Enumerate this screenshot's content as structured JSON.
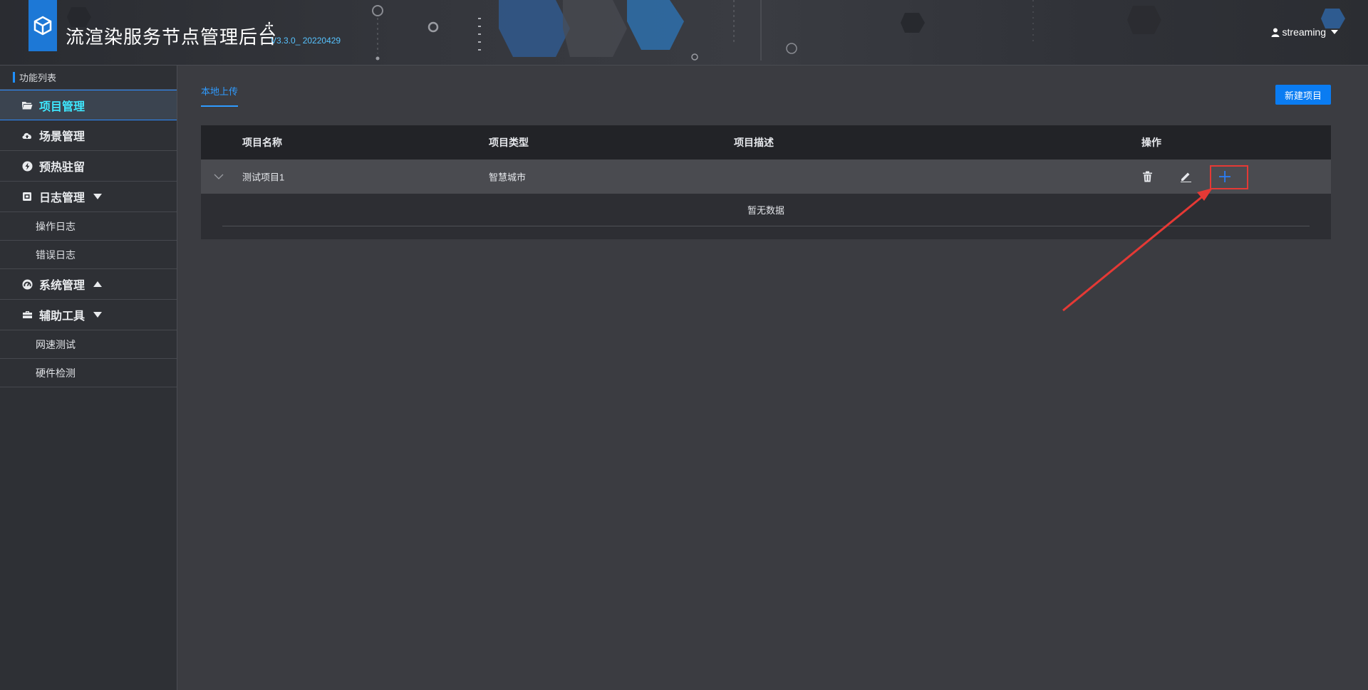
{
  "header": {
    "title": "流渲染服务节点管理后台",
    "sparkle": "✢",
    "version": "V3.3.0_ 20220429",
    "user": "streaming"
  },
  "sidebar": {
    "caption": "功能列表",
    "items": [
      {
        "label": "项目管理",
        "icon": "folder-open-icon",
        "active": true
      },
      {
        "label": "场景管理",
        "icon": "cloud-upload-icon"
      },
      {
        "label": "预热驻留",
        "icon": "bolt-circle-icon"
      },
      {
        "label": "日志管理",
        "icon": "log-box-icon",
        "expanded": true,
        "children": [
          "操作日志",
          "错误日志"
        ]
      },
      {
        "label": "系统管理",
        "icon": "gauge-icon",
        "expanded": false
      },
      {
        "label": "辅助工具",
        "icon": "toolbox-icon",
        "expanded": true,
        "children": [
          "网速测试",
          "硬件检测"
        ]
      }
    ]
  },
  "main": {
    "tab_label": "本地上传",
    "new_button": "新建项目",
    "table": {
      "columns": [
        "项目名称",
        "项目类型",
        "项目描述",
        "操作"
      ],
      "rows": [
        {
          "name": "测试项目1",
          "type": "智慧城市",
          "description": ""
        }
      ],
      "empty_text": "暂无数据"
    }
  },
  "colors": {
    "accent": "#0a7cf2",
    "active_text": "#3ee8ff",
    "highlight": "#e53935"
  }
}
